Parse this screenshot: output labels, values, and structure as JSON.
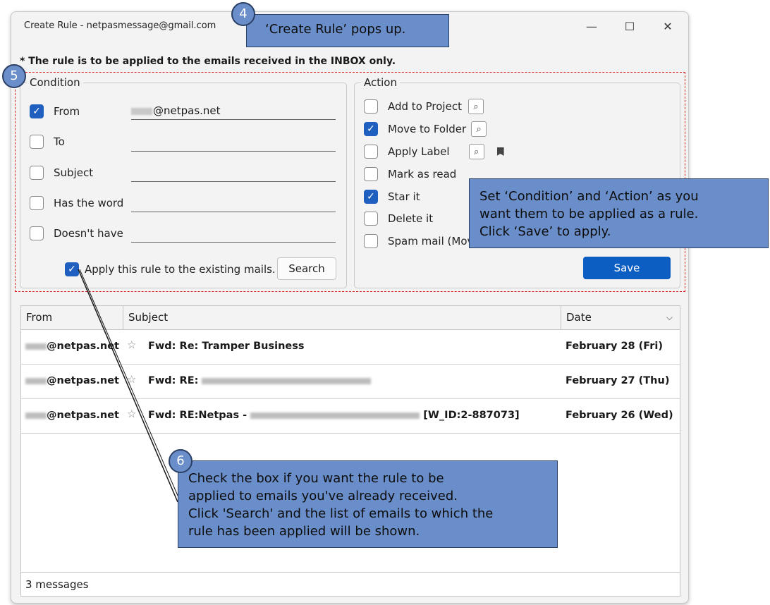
{
  "window": {
    "title": "Create Rule - netpasmessage@gmail.com",
    "minimize_glyph": "—",
    "maximize_glyph": "☐",
    "close_glyph": "✕"
  },
  "note": "* The rule is to be applied to the emails received in the INBOX only.",
  "condition": {
    "legend": "Condition",
    "rows": [
      {
        "label": "From",
        "checked": true,
        "value": "@netpas.net"
      },
      {
        "label": "To",
        "checked": false,
        "value": ""
      },
      {
        "label": "Subject",
        "checked": false,
        "value": ""
      },
      {
        "label": "Has the word",
        "checked": false,
        "value": ""
      },
      {
        "label": "Doesn't have",
        "checked": false,
        "value": ""
      }
    ],
    "apply_existing_label": "Apply this rule to the existing mails.",
    "apply_existing_checked": true,
    "search_button": "Search"
  },
  "action": {
    "legend": "Action",
    "rows": [
      {
        "label": "Add to Project",
        "checked": false
      },
      {
        "label": "Move to Folder",
        "checked": true
      },
      {
        "label": "Apply Label",
        "checked": false
      },
      {
        "label": "Mark as read",
        "checked": false
      },
      {
        "label": "Star it",
        "checked": true
      },
      {
        "label": "Delete it",
        "checked": false
      },
      {
        "label": "Spam mail (Mov",
        "checked": false
      }
    ],
    "save_button": "Save"
  },
  "list": {
    "columns": [
      "From",
      "Subject",
      "Date"
    ],
    "rows": [
      {
        "from": "@netpas.net",
        "subject_prefix": "Fwd: Re: Tramper Business",
        "subject_suffix": "",
        "date": "February 28 (Fri)"
      },
      {
        "from": "@netpas.net",
        "subject_prefix": "Fwd: RE:",
        "subject_suffix": "",
        "date": "February 27 (Thu)"
      },
      {
        "from": "@netpas.net",
        "subject_prefix": "Fwd: RE:Netpas -",
        "subject_suffix": "[W_ID:2-887073]",
        "date": "February 26 (Wed)"
      }
    ],
    "footer": "3 messages"
  },
  "callouts": {
    "c4": {
      "badge": "4",
      "lines": [
        "‘Create Rule’ pops up."
      ]
    },
    "c5": {
      "badge": "5",
      "lines": [
        "Set ‘Condition’ and ‘Action’ as you",
        "want them to be applied as a rule.",
        "Click ‘Save’ to apply."
      ]
    },
    "c6": {
      "badge": "6",
      "lines": [
        "Check the box if you want the rule to be",
        "applied to emails you've already received.",
        "Click 'Search' and the list of emails to which the",
        "rule has been applied will be shown."
      ]
    }
  },
  "colors": {
    "accent": "#1f5fbf",
    "save": "#0d5ec2",
    "callout": "#6a8ec9",
    "dashed": "#d62020"
  }
}
